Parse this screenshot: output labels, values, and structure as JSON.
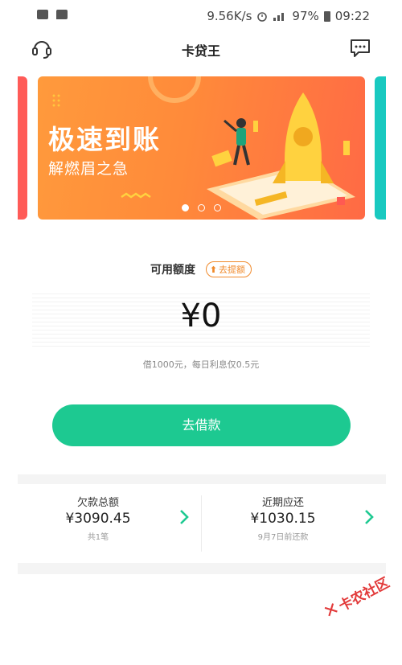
{
  "status_bar": {
    "network_speed": "9.56K/s",
    "battery": "97%",
    "time": "09:22"
  },
  "header": {
    "title": "卡贷王",
    "left_icon": "headset-icon",
    "right_icon": "chat-icon"
  },
  "banner": {
    "title": "极速到账",
    "subtitle": "解燃眉之急",
    "dots": 3,
    "active_dot": 0,
    "colors": {
      "start": "#ff9a3c",
      "end": "#ff6a45"
    }
  },
  "limit": {
    "label": "可用额度",
    "raise_button": "去提额",
    "amount": "¥0",
    "hint": "借1000元，每日利息仅0.5元"
  },
  "borrow_button": {
    "label": "去借款",
    "color": "#1dc991"
  },
  "summary": {
    "left": {
      "label": "欠款总额",
      "value": "¥3090.45",
      "sub": "共1笔"
    },
    "right": {
      "label": "近期应还",
      "value": "¥1030.15",
      "sub": "9月7日前还款"
    }
  },
  "watermark": {
    "text": "卡农社区"
  }
}
